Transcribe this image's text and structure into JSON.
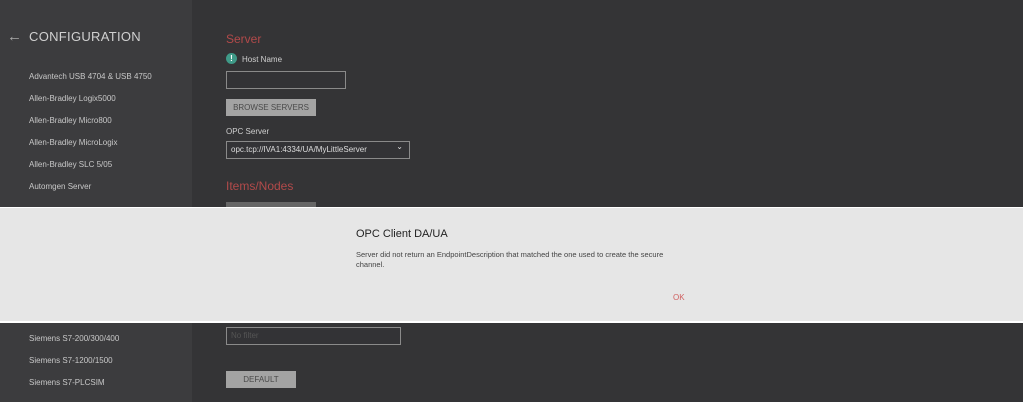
{
  "sidebar": {
    "title": "CONFIGURATION",
    "back_icon": "←",
    "items": [
      "Advantech USB 4704 & USB 4750",
      "Allen-Bradley Logix5000",
      "Allen-Bradley Micro800",
      "Allen-Bradley MicroLogix",
      "Allen-Bradley SLC 5/05",
      "Automgen Server",
      "Siemens S7-200/300/400",
      "Siemens S7-1200/1500",
      "Siemens S7-PLCSIM"
    ]
  },
  "server": {
    "heading": "Server",
    "host_label": "Host Name",
    "host_value": "",
    "browse_label": "BROWSE SERVERS",
    "opc_label": "OPC Server",
    "opc_value": "opc.tcp://IVA1:4334/UA/MyLittleServer",
    "chevron": "⌄"
  },
  "items": {
    "heading": "Items/Nodes",
    "filter_placeholder": "No filter",
    "default_label": "DEFAULT"
  },
  "dialog": {
    "title": "OPC Client DA/UA",
    "message": "Server did not return an EndpointDescription that matched the one used to create the secure channel.",
    "ok_label": "OK"
  },
  "colors": {
    "accent": "#b24a4a",
    "ok": "#d06060"
  }
}
